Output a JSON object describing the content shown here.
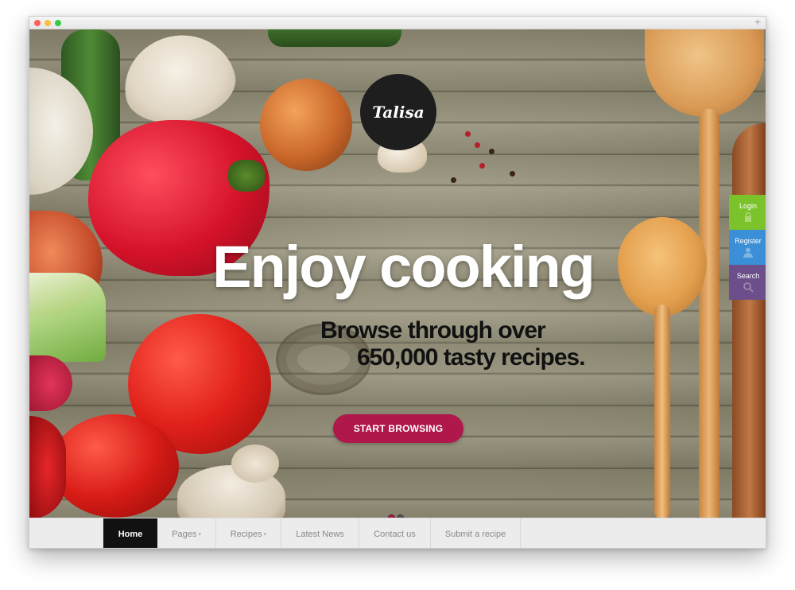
{
  "window": {
    "plus_label": "+"
  },
  "logo": {
    "text": "Talisa"
  },
  "hero": {
    "headline": "Enjoy cooking",
    "subheadline_line1": "Browse through over",
    "subheadline_line2": "650,000 tasty recipes.",
    "cta_label": "START BROWSING",
    "slides_total": 2,
    "active_slide": 1
  },
  "side_tabs": [
    {
      "label": "Login",
      "color": "#7cc32b",
      "icon": "lock-icon"
    },
    {
      "label": "Register",
      "color": "#3b8fd6",
      "icon": "user-icon"
    },
    {
      "label": "Search",
      "color": "#6c4f8a",
      "icon": "search-icon"
    }
  ],
  "nav": {
    "items": [
      {
        "label": "Home",
        "has_dropdown": false,
        "active": true
      },
      {
        "label": "Pages",
        "has_dropdown": true,
        "active": false
      },
      {
        "label": "Recipes",
        "has_dropdown": true,
        "active": false
      },
      {
        "label": "Latest News",
        "has_dropdown": false,
        "active": false
      },
      {
        "label": "Contact us",
        "has_dropdown": false,
        "active": false
      },
      {
        "label": "Submit a recipe",
        "has_dropdown": false,
        "active": false
      }
    ],
    "caret_glyph": "▾"
  },
  "colors": {
    "accent": "#b0174b",
    "nav_active_bg": "#111111",
    "logo_bg": "#1e1e1e"
  }
}
